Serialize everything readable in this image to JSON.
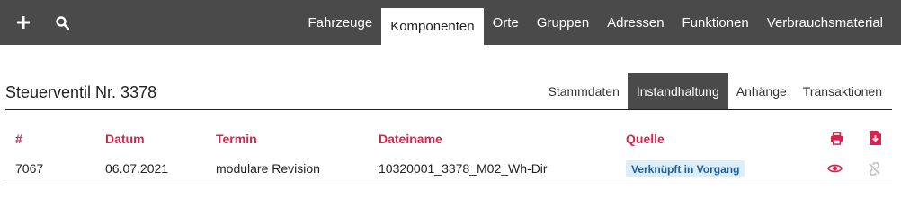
{
  "toolbar": {
    "add_icon": "plus-icon",
    "search_icon": "search-icon"
  },
  "nav": {
    "items": [
      {
        "label": "Fahrzeuge",
        "active": false
      },
      {
        "label": "Komponenten",
        "active": true
      },
      {
        "label": "Orte",
        "active": false
      },
      {
        "label": "Gruppen",
        "active": false
      },
      {
        "label": "Adressen",
        "active": false
      },
      {
        "label": "Funktionen",
        "active": false
      },
      {
        "label": "Verbrauchsmaterial",
        "active": false
      }
    ]
  },
  "page": {
    "title": "Steuerventil Nr. 3378"
  },
  "subtabs": [
    {
      "label": "Stammdaten",
      "active": false
    },
    {
      "label": "Instandhaltung",
      "active": true
    },
    {
      "label": "Anhänge",
      "active": false
    },
    {
      "label": "Transaktionen",
      "active": false
    }
  ],
  "table": {
    "headers": {
      "id": "#",
      "date": "Datum",
      "term": "Termin",
      "filename": "Dateiname",
      "source": "Quelle"
    },
    "header_icons": [
      "print-icon",
      "download-file-icon"
    ],
    "rows": [
      {
        "id": "7067",
        "date": "06.07.2021",
        "term": "modulare Revision",
        "filename": "10320001_3378_M02_Wh-Dir",
        "source_badge": "Verknüpft in Vorgang",
        "row_icons": [
          "view-icon",
          "unlink-icon"
        ]
      }
    ]
  },
  "colors": {
    "topbar": "#4a4a4a",
    "accent": "#d6234f",
    "badge_bg": "#dceefa",
    "badge_text": "#1f5f99"
  }
}
